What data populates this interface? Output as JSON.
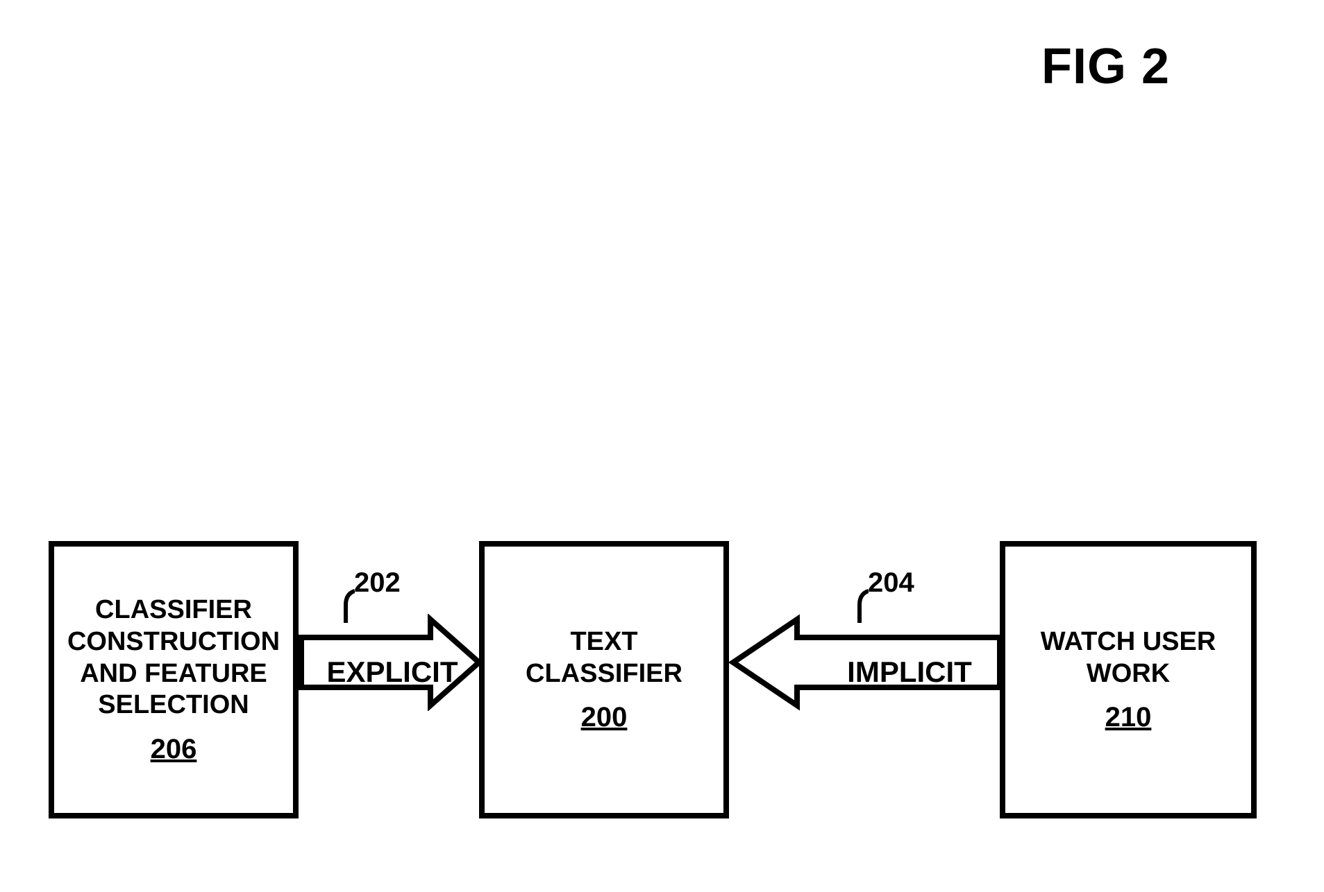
{
  "figure_title": "FIG 2",
  "boxes": {
    "left": {
      "title": "CLASSIFIER CONSTRUCTION AND FEATURE SELECTION",
      "ref": "206"
    },
    "center": {
      "title": "TEXT CLASSIFIER",
      "ref": "200"
    },
    "right": {
      "title": "WATCH USER WORK",
      "ref": "210"
    }
  },
  "arrows": {
    "left_to_center": {
      "label": "EXPLICIT",
      "ref": "202"
    },
    "right_to_center": {
      "label": "IMPLICIT",
      "ref": "204"
    }
  }
}
